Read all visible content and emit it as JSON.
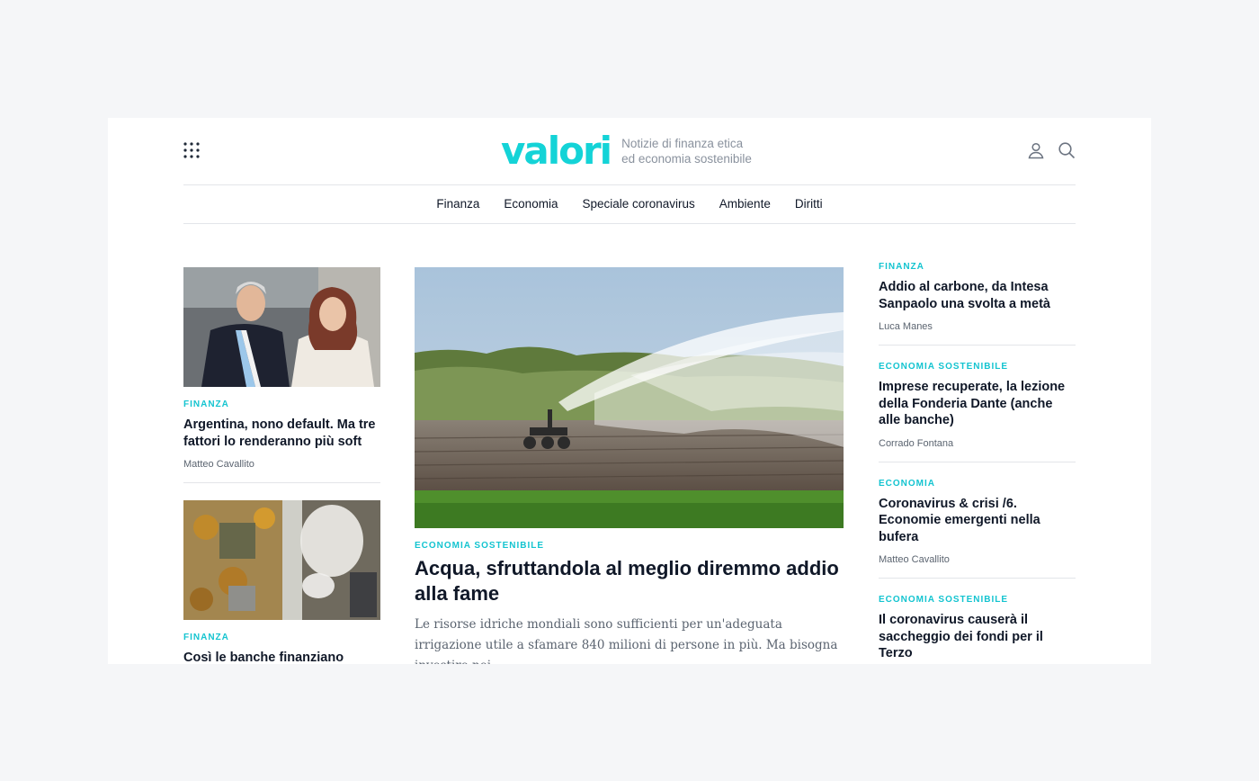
{
  "brand": {
    "logo": "valori",
    "tagline_1": "Notizie di finanza etica",
    "tagline_2": "ed economia sostenibile",
    "accent": "#14d3d7"
  },
  "icons": {
    "menu": "grid-dots-icon",
    "user": "user-icon",
    "search": "search-icon"
  },
  "nav": [
    "Finanza",
    "Economia",
    "Speciale coronavirus",
    "Ambiente",
    "Diritti"
  ],
  "left": [
    {
      "category": "Finanza",
      "title": "Argentina, nono default. Ma tre fattori lo renderanno più soft",
      "author": "Matteo Cavallito"
    },
    {
      "category": "Finanza",
      "title": "Così le banche finanziano"
    }
  ],
  "featured": {
    "category": "Economia sostenibile",
    "title": "Acqua, sfruttandola al meglio diremmo addio alla fame",
    "excerpt": "Le risorse idriche mondiali sono sufficienti per un'adeguata irrigazione utile a sfamare 840 milioni di persone in più. Ma bisogna investire nei"
  },
  "right": [
    {
      "category": "Finanza",
      "title": "Addio al carbone, da Intesa Sanpaolo una svolta a metà",
      "author": "Luca Manes"
    },
    {
      "category": "Economia sostenibile",
      "title": "Imprese recuperate, la lezione della Fonderia Dante (anche alle banche)",
      "author": "Corrado Fontana"
    },
    {
      "category": "Economia",
      "title": "Coronavirus & crisi /6. Economie emergenti nella bufera",
      "author": "Matteo Cavallito"
    },
    {
      "category": "Economia sostenibile",
      "title": "Il coronavirus causerà il saccheggio dei fondi per il Terzo"
    }
  ]
}
